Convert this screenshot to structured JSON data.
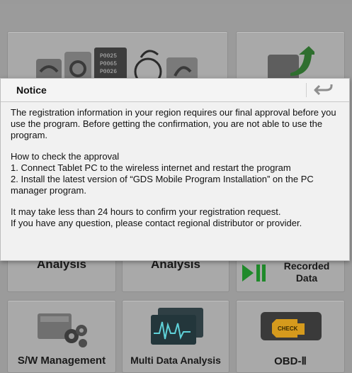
{
  "dialog": {
    "title": "Notice",
    "back_icon": "back-arrow-icon",
    "paragraph1": "The registration information in your region requires our final approval before you use the program. Before getting the confirmation, you are not able to use the program.",
    "how_title": "How to check the approval",
    "step1": "1. Connect Tablet PC to the wireless internet and restart the program",
    "step2": "2. Install the latest version of “GDS Mobile Program Installation” on the PC manager program.",
    "note1": "It may take less than 24 hours to confirm your registration request.",
    "note2": "If you have any question, please contact regional distributor or provider."
  },
  "tiles": {
    "row2": {
      "left_label": "Analysis",
      "middle_label": "Analysis",
      "right_label_line1": "Recorded",
      "right_label_line2": "Data"
    },
    "row3": {
      "left_label": "S/W Management",
      "middle_label": "Multi Data Analysis",
      "right_label": "OBD-Ⅱ"
    },
    "top_icon_codes": [
      "P0025",
      "P0065",
      "P0026"
    ]
  },
  "colors": {
    "dialog_bg": "#f1f1f1",
    "overlay": "#9b9b9b",
    "play_green": "#1f8a2a"
  }
}
